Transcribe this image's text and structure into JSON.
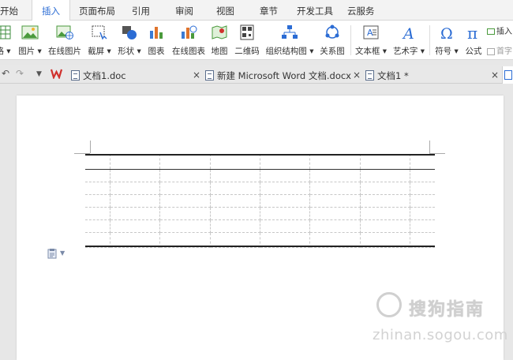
{
  "menu": {
    "tabs": [
      "开始",
      "插入",
      "页面布局",
      "引用",
      "审阅",
      "视图",
      "章节",
      "开发工具",
      "云服务"
    ],
    "active": "插入"
  },
  "ribbon": {
    "tools": [
      {
        "label": "格 ▾",
        "icon": "table-icon"
      },
      {
        "label": "图片 ▾",
        "icon": "picture-icon"
      },
      {
        "label": "在线图片",
        "icon": "online-picture-icon"
      },
      {
        "label": "截屏 ▾",
        "icon": "screenshot-icon"
      },
      {
        "label": "形状 ▾",
        "icon": "shapes-icon"
      },
      {
        "label": "图表",
        "icon": "chart-icon"
      },
      {
        "label": "在线图表",
        "icon": "online-chart-icon"
      },
      {
        "label": "地图",
        "icon": "map-icon"
      },
      {
        "label": "二维码",
        "icon": "qrcode-icon"
      },
      {
        "label": "组织结构图 ▾",
        "icon": "org-chart-icon"
      },
      {
        "label": "关系图",
        "icon": "relation-icon"
      },
      {
        "label": "文本框 ▾",
        "icon": "textbox-icon"
      },
      {
        "label": "艺术字 ▾",
        "icon": "wordart-icon"
      },
      {
        "label": "符号 ▾",
        "icon": "omega-icon"
      },
      {
        "label": "公式",
        "icon": "pi-icon"
      }
    ],
    "side_items": [
      "插入",
      "首字"
    ]
  },
  "docbar": {
    "tabs": [
      {
        "label": "文档1.doc"
      },
      {
        "label": "新建 Microsoft Word 文档.docx"
      },
      {
        "label": "文档1 *"
      }
    ],
    "close": "×"
  },
  "watermark": {
    "text": "搜狗指南",
    "url": "zhinan.sogou.com"
  },
  "colors": {
    "accent": "#2b6cd4",
    "wps_red": "#d0312d"
  }
}
